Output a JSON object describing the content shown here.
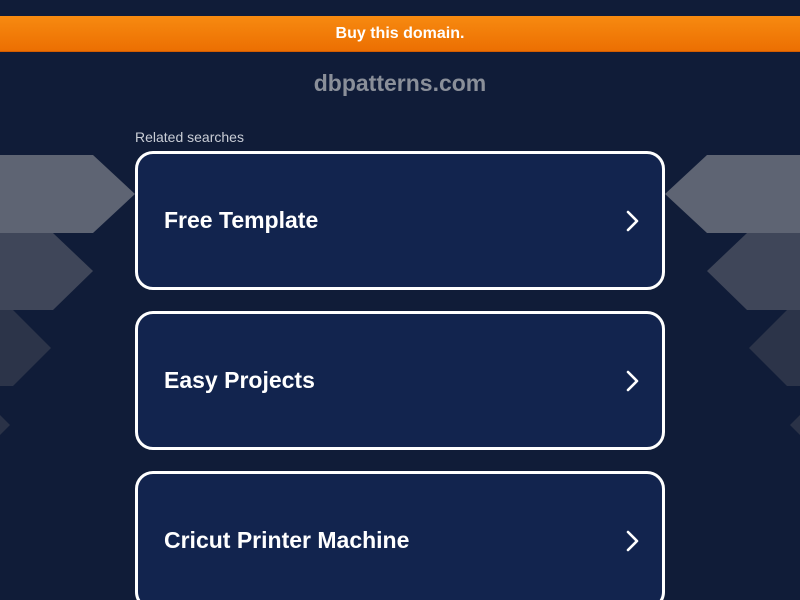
{
  "banner": {
    "label": "Buy this domain.",
    "color": "#f07a08"
  },
  "domain": {
    "name": "dbpatterns.com"
  },
  "related": {
    "label": "Related searches",
    "items": [
      {
        "label": "Free Template"
      },
      {
        "label": "Easy Projects"
      },
      {
        "label": "Cricut Printer Machine"
      }
    ]
  },
  "colors": {
    "background": "#101c38",
    "card": "#12244e",
    "card_border": "#ffffff"
  }
}
